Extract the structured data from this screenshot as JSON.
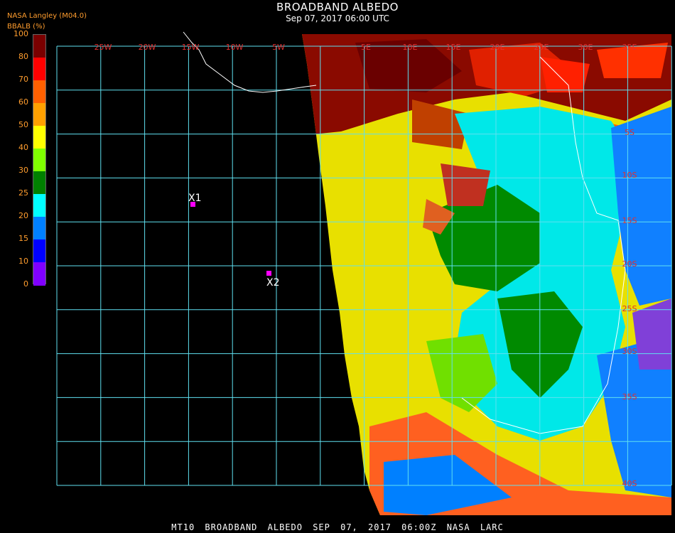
{
  "header": {
    "title": "BROADBAND ALBEDO",
    "subtitle": "Sep 07, 2017 06:00 UTC",
    "source": "NASA Langley (M04.0)",
    "units": "BBALB (%)"
  },
  "colorbar": {
    "ticks": [
      "100",
      "80",
      "70",
      "60",
      "50",
      "40",
      "30",
      "25",
      "20",
      "15",
      "10",
      "0"
    ],
    "colors": [
      "#7a0000",
      "#ff0000",
      "#ff6000",
      "#ffa000",
      "#ffff00",
      "#80ff00",
      "#008000",
      "#00ffff",
      "#0080ff",
      "#0000ff",
      "#8000ff"
    ]
  },
  "map": {
    "lon_labels": [
      "25W",
      "20W",
      "15W",
      "10W",
      "5W",
      "5E",
      "10E",
      "15E",
      "20E",
      "25E",
      "30E",
      "35E"
    ],
    "lat_labels": [
      "5S",
      "10S",
      "15S",
      "20S",
      "25S",
      "30S",
      "35S",
      "40S"
    ],
    "markers": [
      {
        "label": "X1"
      },
      {
        "label": "X2"
      }
    ]
  },
  "footer": "MT10  BROADBAND ALBEDO  SEP 07, 2017 06:00Z  NASA LARC"
}
